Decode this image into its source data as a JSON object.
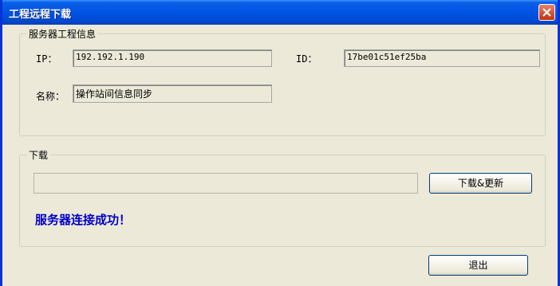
{
  "window": {
    "title": "工程远程下载"
  },
  "server_group": {
    "title": "服务器工程信息",
    "ip_label": "IP：",
    "ip_value": "192.192.1.190",
    "id_label": "ID：",
    "id_value": "17be01c51ef25ba",
    "name_label": "名称：",
    "name_value": "操作站间信息同步"
  },
  "download_group": {
    "title": "下载",
    "progress": 0,
    "download_button": "下载&更新",
    "status": "服务器连接成功！"
  },
  "footer": {
    "exit_button": "退出"
  },
  "icons": {
    "close": "close-icon"
  },
  "colors": {
    "titlebar": "#0054e3",
    "status_text": "#0000c8",
    "close_button": "#c1330d"
  }
}
